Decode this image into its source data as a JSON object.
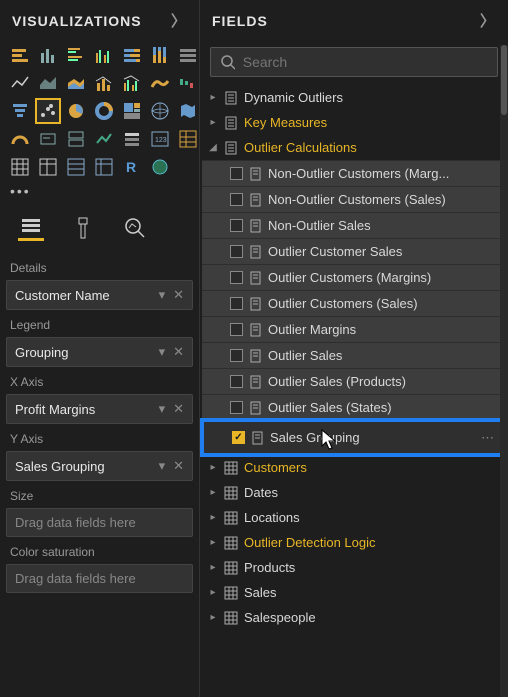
{
  "visualizations": {
    "title": "VISUALIZATIONS",
    "wells": {
      "details_label": "Details",
      "details_value": "Customer Name",
      "legend_label": "Legend",
      "legend_value": "Grouping",
      "xaxis_label": "X Axis",
      "xaxis_value": "Profit Margins",
      "yaxis_label": "Y Axis",
      "yaxis_value": "Sales Grouping",
      "size_label": "Size",
      "size_placeholder": "Drag data fields here",
      "colorsat_label": "Color saturation",
      "colorsat_placeholder": "Drag data fields here"
    }
  },
  "fields": {
    "title": "FIELDS",
    "search_placeholder": "Search",
    "tables": [
      {
        "name": "Dynamic Outliers",
        "expanded": false,
        "gold": false
      },
      {
        "name": "Key Measures",
        "expanded": false,
        "gold": true
      },
      {
        "name": "Outlier Calculations",
        "expanded": true,
        "gold": true,
        "columns": [
          {
            "name": "Non-Outlier Customers (Marg...",
            "checked": false
          },
          {
            "name": "Non-Outlier Customers (Sales)",
            "checked": false
          },
          {
            "name": "Non-Outlier Sales",
            "checked": false
          },
          {
            "name": "Outlier Customer Sales",
            "checked": false
          },
          {
            "name": "Outlier Customers (Margins)",
            "checked": false
          },
          {
            "name": "Outlier Customers (Sales)",
            "checked": false
          },
          {
            "name": "Outlier Margins",
            "checked": false
          },
          {
            "name": "Outlier Sales",
            "checked": false
          },
          {
            "name": "Outlier Sales (Products)",
            "checked": false
          },
          {
            "name": "Outlier Sales (States)",
            "checked": false
          },
          {
            "name": "Sales Grouping",
            "checked": true,
            "selected": true
          }
        ]
      },
      {
        "name": "Customers",
        "expanded": false,
        "gold": true,
        "grid": true
      },
      {
        "name": "Dates",
        "expanded": false,
        "gold": false,
        "grid": true
      },
      {
        "name": "Locations",
        "expanded": false,
        "gold": false,
        "grid": true
      },
      {
        "name": "Outlier Detection Logic",
        "expanded": false,
        "gold": true,
        "grid": true
      },
      {
        "name": "Products",
        "expanded": false,
        "gold": false,
        "grid": true
      },
      {
        "name": "Sales",
        "expanded": false,
        "gold": false,
        "grid": true
      },
      {
        "name": "Salespeople",
        "expanded": false,
        "gold": false,
        "grid": true
      }
    ]
  }
}
